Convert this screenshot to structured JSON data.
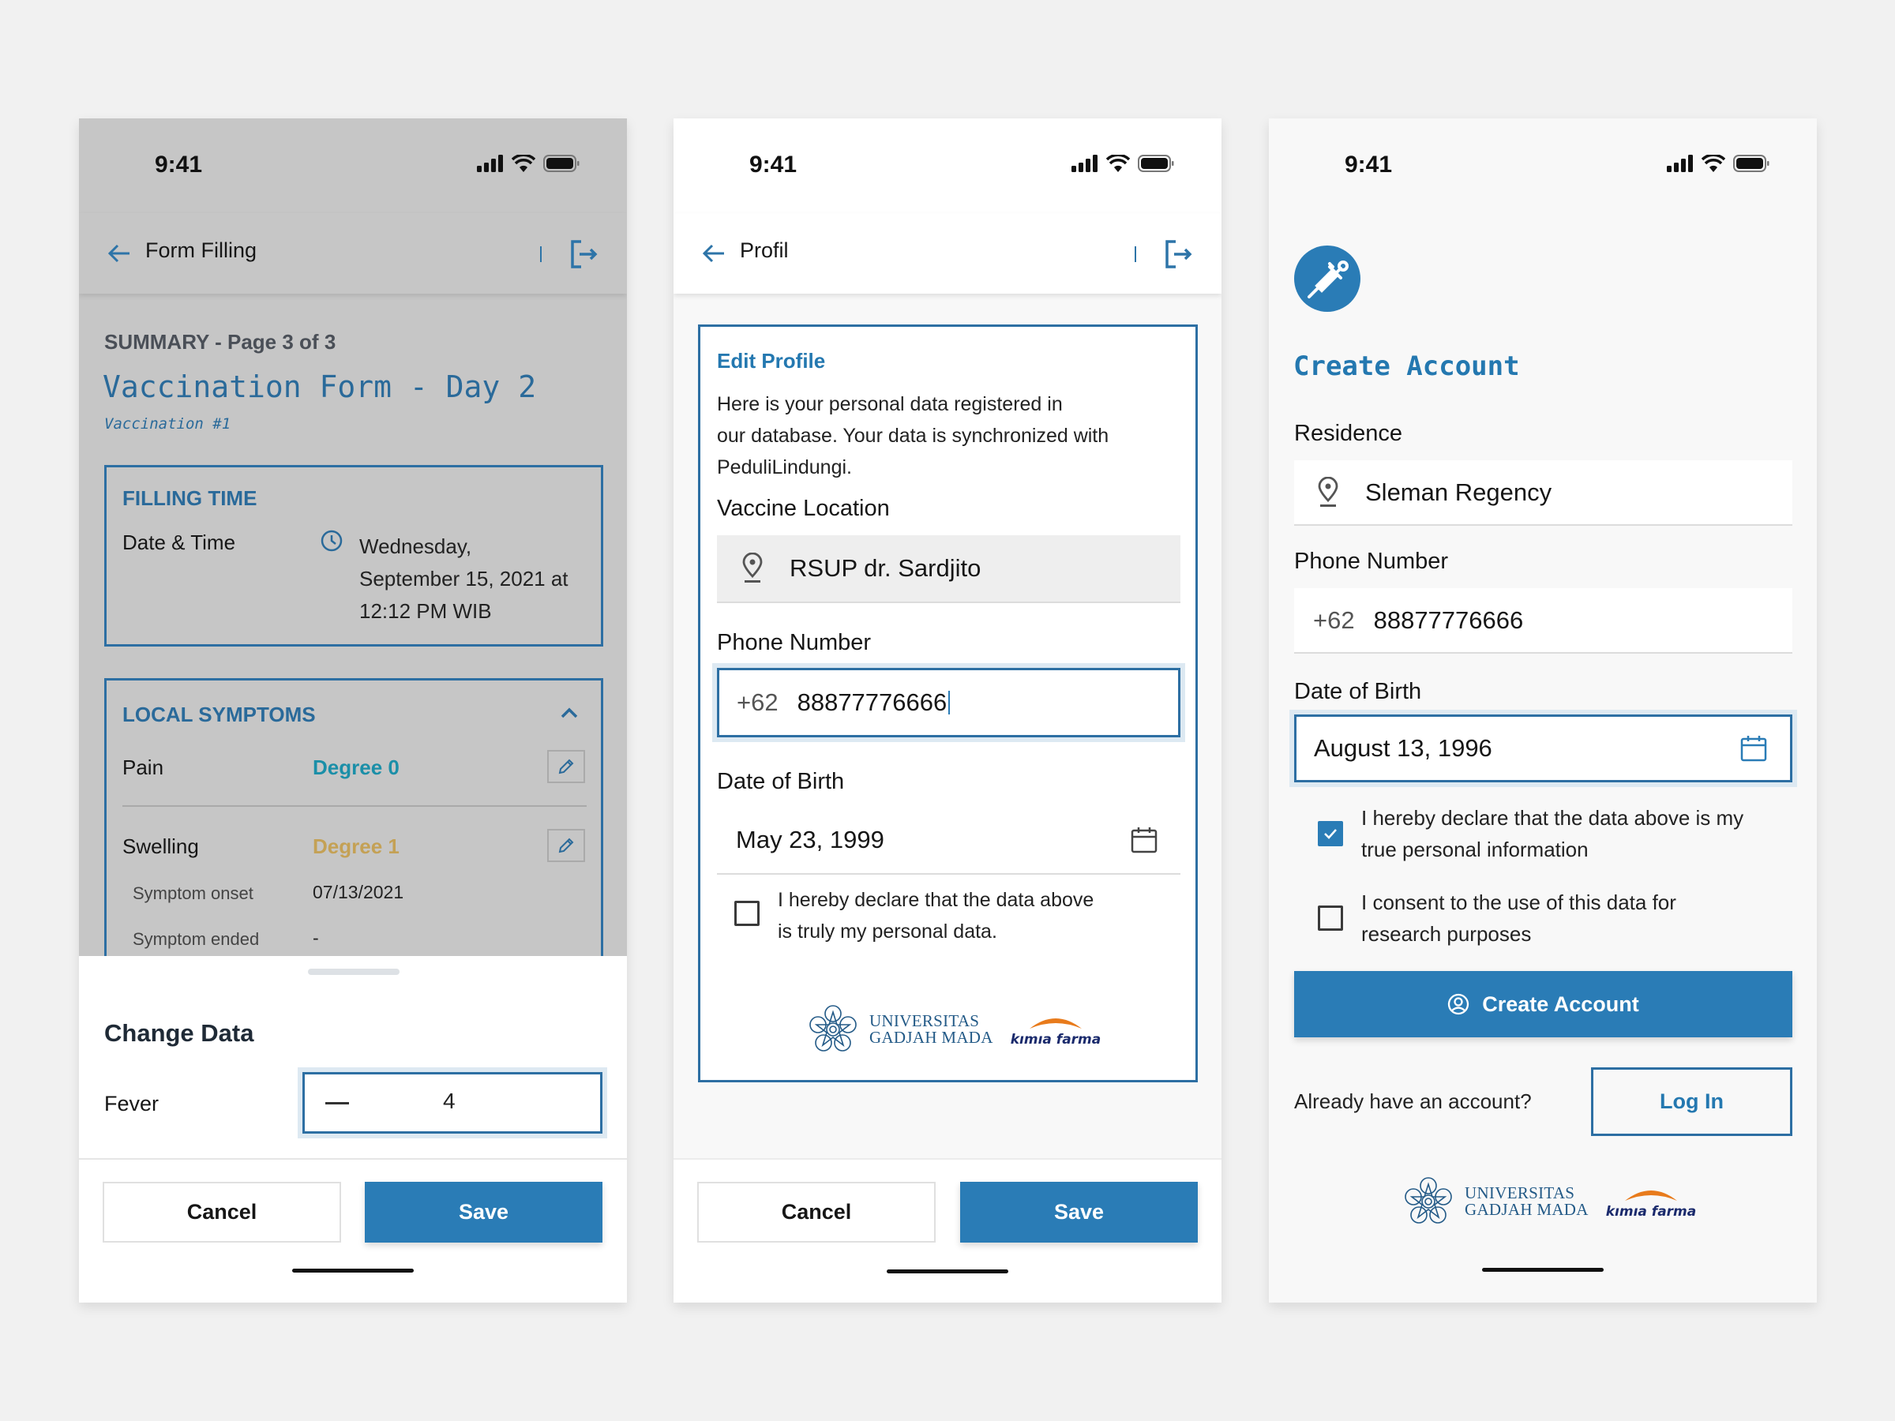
{
  "status_bar": {
    "time": "9:41"
  },
  "colors": {
    "accent": "#2a7cb6",
    "border_blue": "#2d6fa3",
    "degree0": "#1b8fa8",
    "degree1": "#c4a155",
    "overlay_grey": "#c6c6c6"
  },
  "screen1": {
    "header": {
      "title": "Form Filling",
      "back_icon": "arrow-left-icon",
      "logout_icon": "logout-icon"
    },
    "page_indicator": "SUMMARY - Page 3 of 3",
    "form_title": "Vaccination Form - Day 2",
    "form_subtitle": "Vaccination #1",
    "filling_time": {
      "heading": "FILLING TIME",
      "label": "Date & Time",
      "value_lines": [
        "Wednesday,",
        "September 15, 2021 at",
        "12:12 PM WIB"
      ]
    },
    "local_symptoms": {
      "heading": "LOCAL SYMPTOMS",
      "rows": [
        {
          "label": "Pain",
          "value": "Degree 0"
        },
        {
          "label": "Swelling",
          "value": "Degree 1"
        }
      ],
      "details": [
        {
          "label": "Symptom onset",
          "value": "07/13/2021"
        },
        {
          "label": "Symptom ended",
          "value": "-"
        }
      ]
    },
    "sheet": {
      "title": "Change Data",
      "field_label": "Fever",
      "stepper_value": "4",
      "cancel_label": "Cancel",
      "save_label": "Save"
    }
  },
  "screen2": {
    "header": {
      "title": "Profil"
    },
    "card": {
      "title": "Edit Profile",
      "description_lines": [
        "Here is your personal data registered in",
        "our database. Your data is synchronized with",
        "PeduliLindungi."
      ],
      "vaccine_location_label": "Vaccine Location",
      "vaccine_location_value": "RSUP dr. Sardjito",
      "phone_label": "Phone Number",
      "phone_prefix": "+62",
      "phone_value": "88877776666",
      "dob_label": "Date of Birth",
      "dob_value": "May 23, 1999",
      "declare_lines": [
        "I hereby declare that the data above",
        "is truly my personal data."
      ],
      "declare_checked": false
    },
    "logos": {
      "ugm_line1": "UNIVERSITAS",
      "ugm_line2": "GADJAH MADA",
      "kimia_farma": "kımıa farma"
    },
    "cancel_label": "Cancel",
    "save_label": "Save"
  },
  "screen3": {
    "title": "Create Account",
    "residence_label": "Residence",
    "residence_value": "Sleman Regency",
    "phone_label": "Phone Number",
    "phone_prefix": "+62",
    "phone_value": "88877776666",
    "dob_label": "Date of Birth",
    "dob_value": "August 13, 1996",
    "checkbox1_lines": [
      "I hereby declare that the data above is my",
      "true personal information"
    ],
    "checkbox1_checked": true,
    "checkbox2_lines": [
      "I consent to the use of this data for",
      "research purposes"
    ],
    "checkbox2_checked": false,
    "create_button": "Create Account",
    "login_prompt": "Already have an account?",
    "login_button": "Log In",
    "logos": {
      "ugm_line1": "UNIVERSITAS",
      "ugm_line2": "GADJAH MADA",
      "kimia_farma": "kımıa farma"
    }
  }
}
